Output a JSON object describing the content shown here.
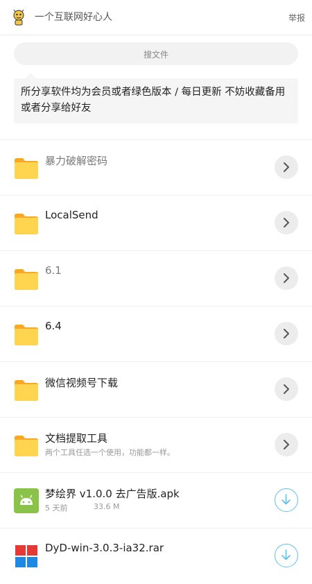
{
  "header": {
    "username": "一个互联网好心人",
    "report_label": "举报",
    "avatar_icon": "cartoon-avatar-icon"
  },
  "search": {
    "placeholder": "搜文件"
  },
  "notice": {
    "text": "所分享软件均为会员或者绿色版本 / 每日更新 不妨收藏备用或者分享给好友"
  },
  "items": [
    {
      "name": "暴力破解密码",
      "type": "folder",
      "icon": "folder-icon",
      "action": "chevron-right-icon"
    },
    {
      "name": "LocalSend",
      "type": "folder",
      "icon": "folder-icon",
      "action": "chevron-right-icon"
    },
    {
      "name": "6.1",
      "type": "folder",
      "icon": "folder-icon",
      "action": "chevron-right-icon"
    },
    {
      "name": "6.4",
      "type": "folder",
      "icon": "folder-icon",
      "action": "chevron-right-icon"
    },
    {
      "name": "微信视频号下载",
      "type": "folder",
      "icon": "folder-icon",
      "action": "chevron-right-icon"
    },
    {
      "name": "文档提取工具",
      "type": "folder",
      "icon": "folder-icon",
      "desc": "两个工具任选一个使用，功能都一样。",
      "action": "chevron-right-icon"
    },
    {
      "name": "梦绘界 v1.0.0 去广告版.apk",
      "type": "apk",
      "icon": "android-app-icon",
      "time": "5 天前",
      "size": "33.6 M",
      "action": "download-icon"
    },
    {
      "name": "DyD-win-3.0.3-ia32.rar",
      "type": "rar",
      "icon": "archive-file-icon",
      "action": "download-icon"
    }
  ],
  "colors": {
    "folder": "#FFD54F",
    "folder_tab": "#F9A825",
    "download_accent": "#5BC0F0",
    "android": "#8BC34A"
  }
}
